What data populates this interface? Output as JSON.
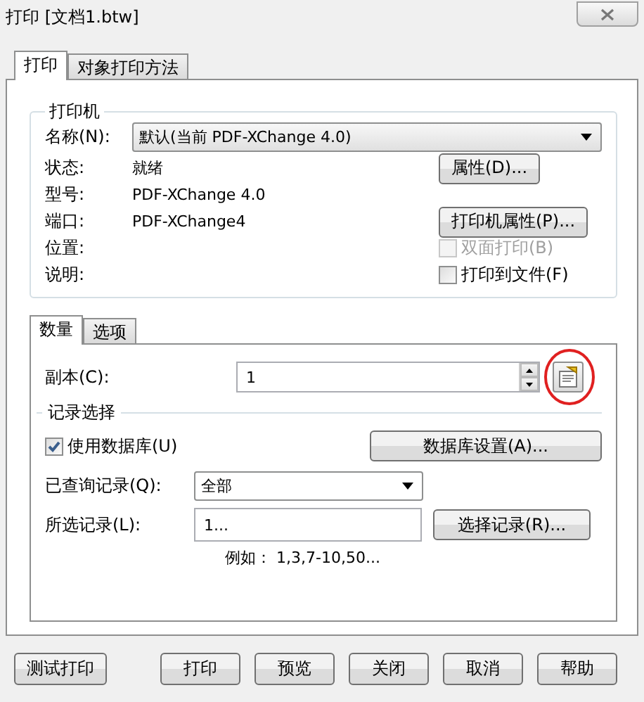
{
  "window": {
    "title": "打印 [文档1.btw]"
  },
  "tabs": [
    {
      "label": "打印",
      "selected": true
    },
    {
      "label": "对象打印方法",
      "selected": false
    }
  ],
  "printer": {
    "title": "打印机",
    "name_label": "名称(N):",
    "name_value": "默认(当前 PDF-XChange 4.0)",
    "info": [
      {
        "label": "状态:",
        "value": "就绪"
      },
      {
        "label": "型号:",
        "value": "PDF-XChange 4.0"
      },
      {
        "label": "端口:",
        "value": "PDF-XChange4"
      },
      {
        "label": "位置:"
      },
      {
        "label": "说明:"
      }
    ],
    "buttons": [
      "属性(D)...",
      "打印机属性(P)..."
    ],
    "checkboxes": [
      {
        "label": "双面打印(B)",
        "checked": false,
        "disabled": true
      },
      {
        "label": "打印到文件(F)",
        "checked": false,
        "disabled": false
      }
    ]
  },
  "sub_tabs": [
    {
      "label": "数量",
      "selected": true
    },
    {
      "label": "选项",
      "selected": false
    }
  ],
  "copies": {
    "label": "副本(C):",
    "value": "1",
    "highlighted": true
  },
  "records": {
    "title": "记录选择",
    "use_database": {
      "label": "使用数据库(U)",
      "checked": true
    },
    "db_button": "数据库设置(A)...",
    "query_label": "已查询记录(Q):",
    "query_value": "全部",
    "selected_label": "所选记录(L):",
    "selected_value": "1...",
    "select_button": "选择记录(R)...",
    "example": "例如： 1,3,7-10,50..."
  },
  "footer_buttons": [
    "测试打印",
    "打印",
    "预览",
    "关闭",
    "取消",
    "帮助"
  ]
}
